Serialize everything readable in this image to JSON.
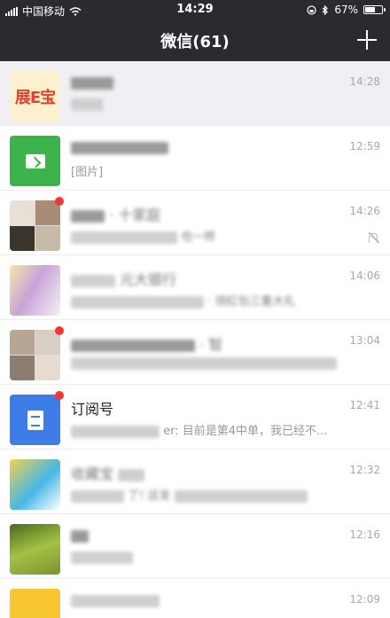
{
  "status_bar": {
    "carrier": "中国移动",
    "time": "14:29",
    "battery": "67%",
    "battery_level": 0.67
  },
  "nav": {
    "title": "微信(61)"
  },
  "chats": [
    {
      "avatar_text": "展E宝",
      "time": "14:28"
    },
    {
      "preview": "[图片]",
      "time": "12:59"
    },
    {
      "name": "· 十家庭",
      "preview": "也一样",
      "time": "14:26",
      "muted": true
    },
    {
      "name": "元大银行",
      "preview": "· 领红包三重大礼",
      "time": "14:06"
    },
    {
      "name": "· 智",
      "time": "13:04"
    },
    {
      "name": "订阅号",
      "preview": "er: 目前是第4中单，我已经不...",
      "time": "12:41"
    },
    {
      "name": "收藏宝",
      "preview": "了! 这支",
      "time": "12:32"
    },
    {
      "time": "12:16"
    },
    {
      "time": "12:09"
    }
  ],
  "colors": {
    "nav_bg": "#2a2a2f",
    "badge_red": "#f43530",
    "wechat_green": "#3db34b",
    "subscription_blue": "#3e7de8"
  }
}
